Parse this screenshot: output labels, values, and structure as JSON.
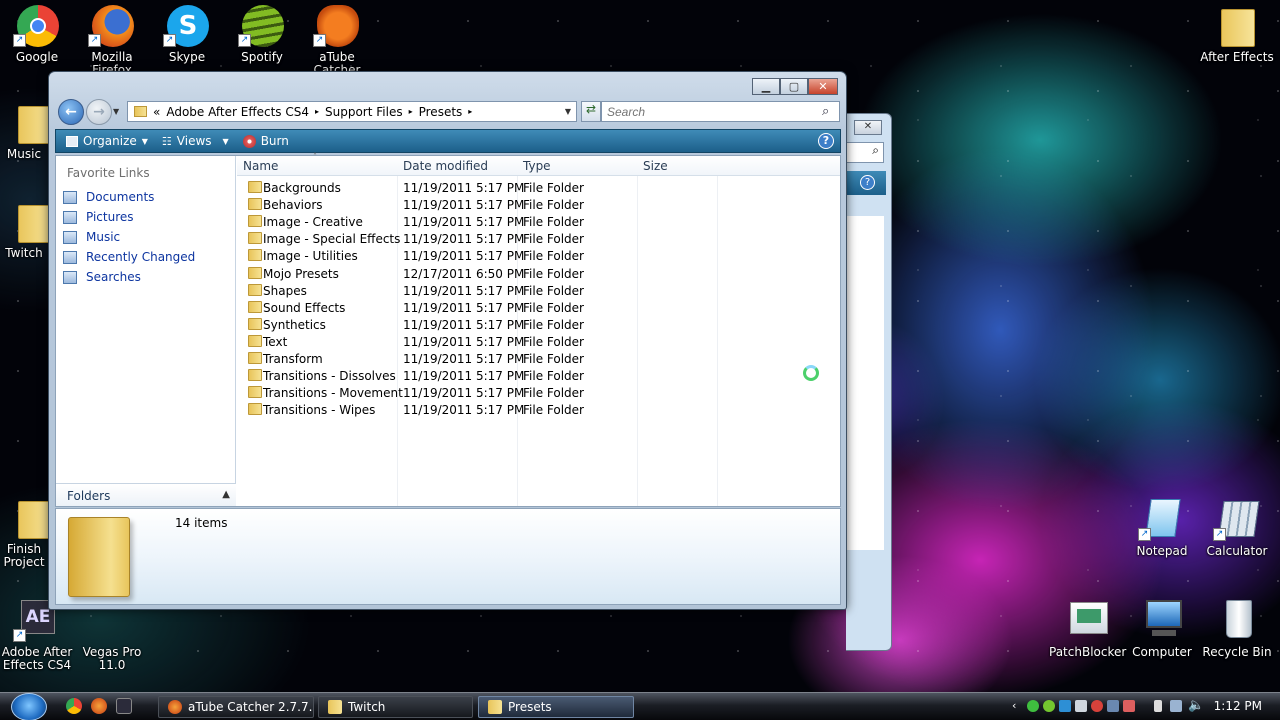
{
  "desktop": {
    "icons": [
      {
        "label": "Google"
      },
      {
        "label": "Mozilla Firefox"
      },
      {
        "label": "Skype"
      },
      {
        "label": "Spotify"
      },
      {
        "label": "aTube Catcher"
      },
      {
        "label": "After Effects"
      },
      {
        "label": "Music"
      },
      {
        "label": "Twitch"
      },
      {
        "label": "Finish Project"
      },
      {
        "label": "Adobe After Effects CS4"
      },
      {
        "label": "Vegas Pro 11.0"
      },
      {
        "label": "Notepad"
      },
      {
        "label": "Calculator"
      },
      {
        "label": "PatchBlocker"
      },
      {
        "label": "Computer"
      },
      {
        "label": "Recycle Bin"
      }
    ]
  },
  "window": {
    "address": {
      "prefix": "«",
      "crumbs": [
        "Adobe After Effects CS4",
        "Support Files",
        "Presets"
      ],
      "sep": "▸"
    },
    "search": {
      "placeholder": "Search"
    },
    "toolbar": {
      "organize": "Organize",
      "views": "Views",
      "burn": "Burn",
      "help": "?"
    },
    "nav": {
      "favorite_header": "Favorite Links",
      "links": [
        "Documents",
        "Pictures",
        "Music",
        "Recently Changed",
        "Searches"
      ],
      "folders_label": "Folders"
    },
    "columns": {
      "name": "Name",
      "date": "Date modified",
      "type": "Type",
      "size": "Size"
    },
    "files": [
      {
        "name": "Backgrounds",
        "date": "11/19/2011 5:17 PM",
        "type": "File Folder"
      },
      {
        "name": "Behaviors",
        "date": "11/19/2011 5:17 PM",
        "type": "File Folder"
      },
      {
        "name": "Image - Creative",
        "date": "11/19/2011 5:17 PM",
        "type": "File Folder"
      },
      {
        "name": "Image - Special Effects",
        "date": "11/19/2011 5:17 PM",
        "type": "File Folder"
      },
      {
        "name": "Image - Utilities",
        "date": "11/19/2011 5:17 PM",
        "type": "File Folder"
      },
      {
        "name": "Mojo Presets",
        "date": "12/17/2011 6:50 PM",
        "type": "File Folder"
      },
      {
        "name": "Shapes",
        "date": "11/19/2011 5:17 PM",
        "type": "File Folder"
      },
      {
        "name": "Sound Effects",
        "date": "11/19/2011 5:17 PM",
        "type": "File Folder"
      },
      {
        "name": "Synthetics",
        "date": "11/19/2011 5:17 PM",
        "type": "File Folder"
      },
      {
        "name": "Text",
        "date": "11/19/2011 5:17 PM",
        "type": "File Folder"
      },
      {
        "name": "Transform",
        "date": "11/19/2011 5:17 PM",
        "type": "File Folder"
      },
      {
        "name": "Transitions - Dissolves",
        "date": "11/19/2011 5:17 PM",
        "type": "File Folder"
      },
      {
        "name": "Transitions - Movement",
        "date": "11/19/2011 5:17 PM",
        "type": "File Folder"
      },
      {
        "name": "Transitions - Wipes",
        "date": "11/19/2011 5:17 PM",
        "type": "File Folder"
      }
    ],
    "details": {
      "count": "14 items"
    }
  },
  "taskbar": {
    "buttons": [
      "aTube Catcher 2.7.7...",
      "Twitch",
      "Presets"
    ],
    "clock": "1:12 PM"
  },
  "colors": {
    "toolbar": "#1c5f8a",
    "link": "#0d35a0",
    "folder": "#e8c45a"
  }
}
